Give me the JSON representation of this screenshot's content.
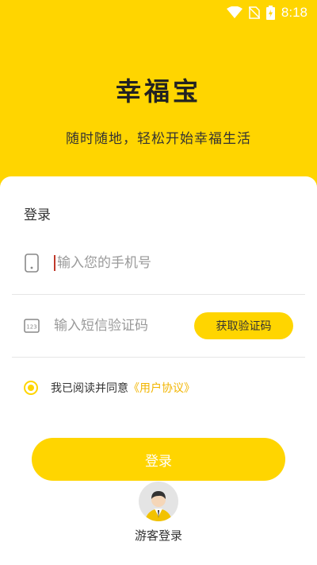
{
  "status_bar": {
    "time": "8:18",
    "icons": [
      "wifi-icon",
      "no-sim-icon",
      "battery-charging-icon"
    ]
  },
  "header": {
    "title": "幸福宝",
    "subtitle": "随时随地，轻松开始幸福生活"
  },
  "login": {
    "heading": "登录",
    "phone_placeholder": "输入您的手机号",
    "code_placeholder": "输入短信验证码",
    "get_code_label": "获取验证码",
    "agree_text": "我已阅读并同意",
    "agreement_link": "《用户协议》",
    "submit_label": "登录"
  },
  "guest": {
    "label": "游客登录"
  },
  "colors": {
    "accent": "#FFD500",
    "link": "#F2B500"
  }
}
